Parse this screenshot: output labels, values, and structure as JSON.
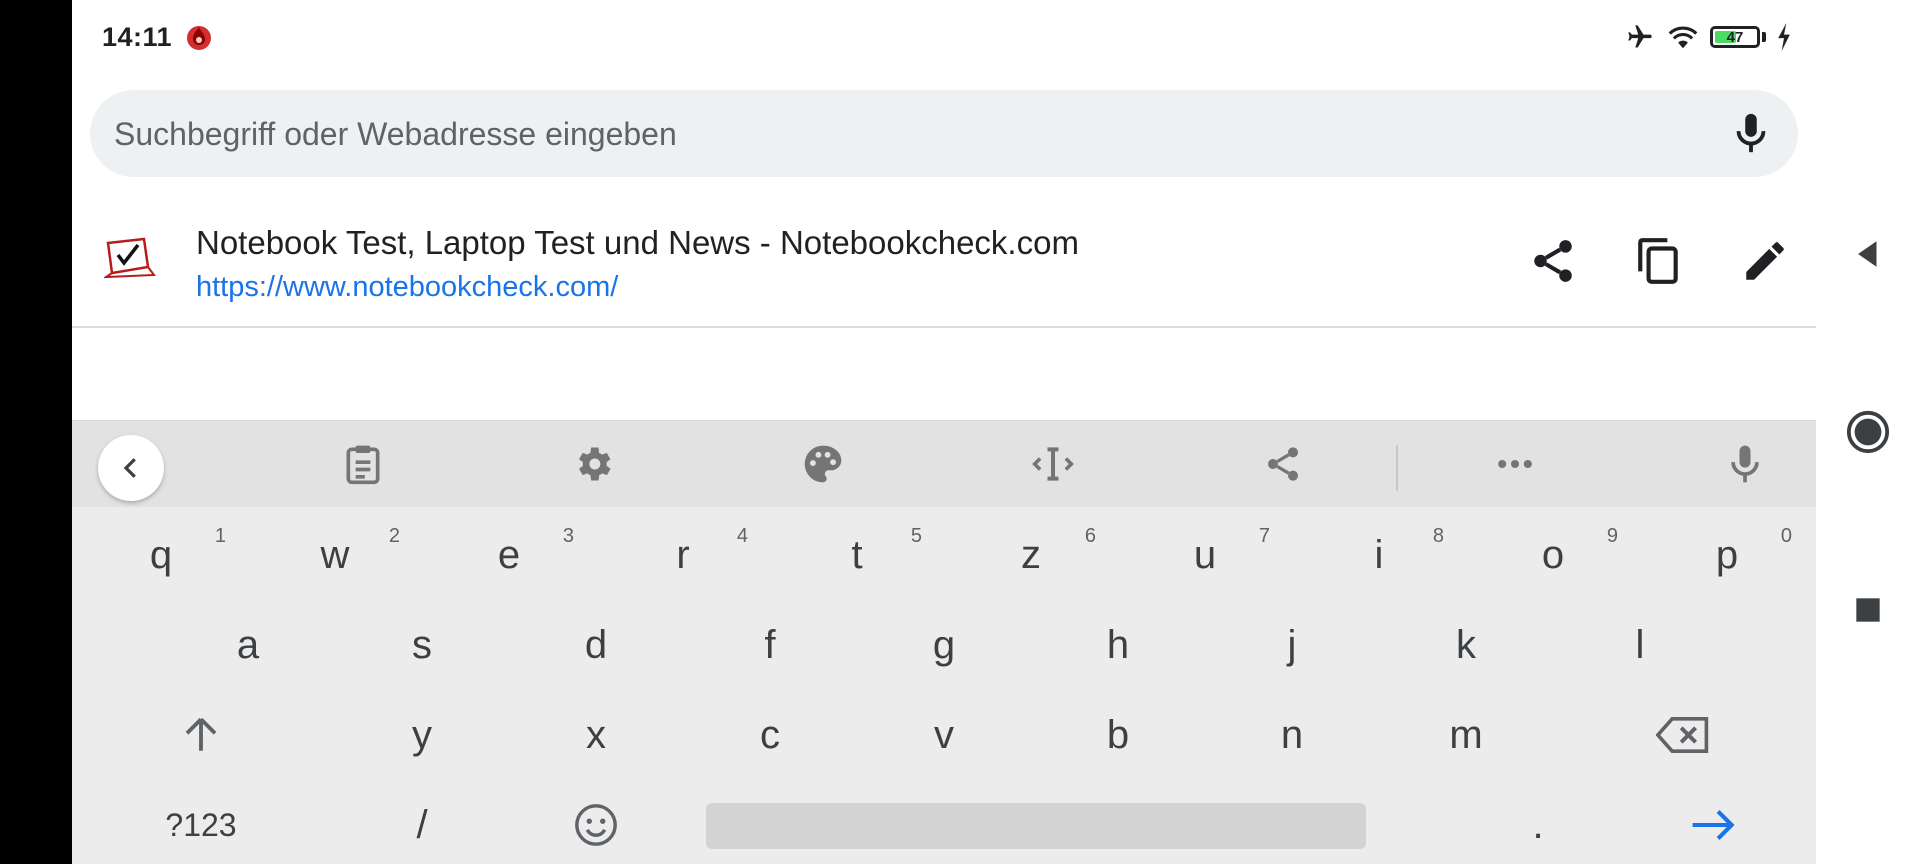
{
  "status_bar": {
    "time": "14:11",
    "app_icon": "antutu-flame-icon",
    "airplane_icon": "airplane-icon",
    "wifi_icon": "wifi-icon",
    "battery_level": "47",
    "charging_icon": "charging-bolt-icon"
  },
  "search": {
    "placeholder": "Suchbegriff oder Webadresse eingeben",
    "value": "",
    "mic_icon": "microphone-icon"
  },
  "suggestion": {
    "title": "Notebook Test, Laptop Test und News - Notebookcheck.com",
    "url": "https://www.notebookcheck.com/",
    "site_icon": "notebookcheck-logo-icon",
    "actions": [
      "share-icon",
      "copy-icon",
      "edit-icon"
    ]
  },
  "keyboard": {
    "toolbar": [
      "back-chevron-icon",
      "clipboard-icon",
      "settings-gear-icon",
      "theme-palette-icon",
      "text-cursor-icon",
      "share-icon",
      "more-dots-icon",
      "microphone-icon"
    ],
    "row1": [
      {
        "key": "q",
        "hint": "1"
      },
      {
        "key": "w",
        "hint": "2"
      },
      {
        "key": "e",
        "hint": "3"
      },
      {
        "key": "r",
        "hint": "4"
      },
      {
        "key": "t",
        "hint": "5"
      },
      {
        "key": "z",
        "hint": "6"
      },
      {
        "key": "u",
        "hint": "7"
      },
      {
        "key": "i",
        "hint": "8"
      },
      {
        "key": "o",
        "hint": "9"
      },
      {
        "key": "p",
        "hint": "0"
      }
    ],
    "row2": [
      "a",
      "s",
      "d",
      "f",
      "g",
      "h",
      "j",
      "k",
      "l"
    ],
    "row3": [
      "y",
      "x",
      "c",
      "v",
      "b",
      "n",
      "m"
    ],
    "shift_icon": "shift-arrow-icon",
    "backspace_icon": "backspace-icon",
    "symbols_label": "?123",
    "slash_key": "/",
    "emoji_icon": "emoji-smile-icon",
    "period_key": ".",
    "enter_icon": "enter-arrow-icon",
    "enter_color": "#1a73e8"
  },
  "nav_bar": {
    "back_icon": "nav-back-triangle-icon",
    "home_icon": "nav-home-circle-icon",
    "recents_icon": "nav-recents-square-icon"
  }
}
